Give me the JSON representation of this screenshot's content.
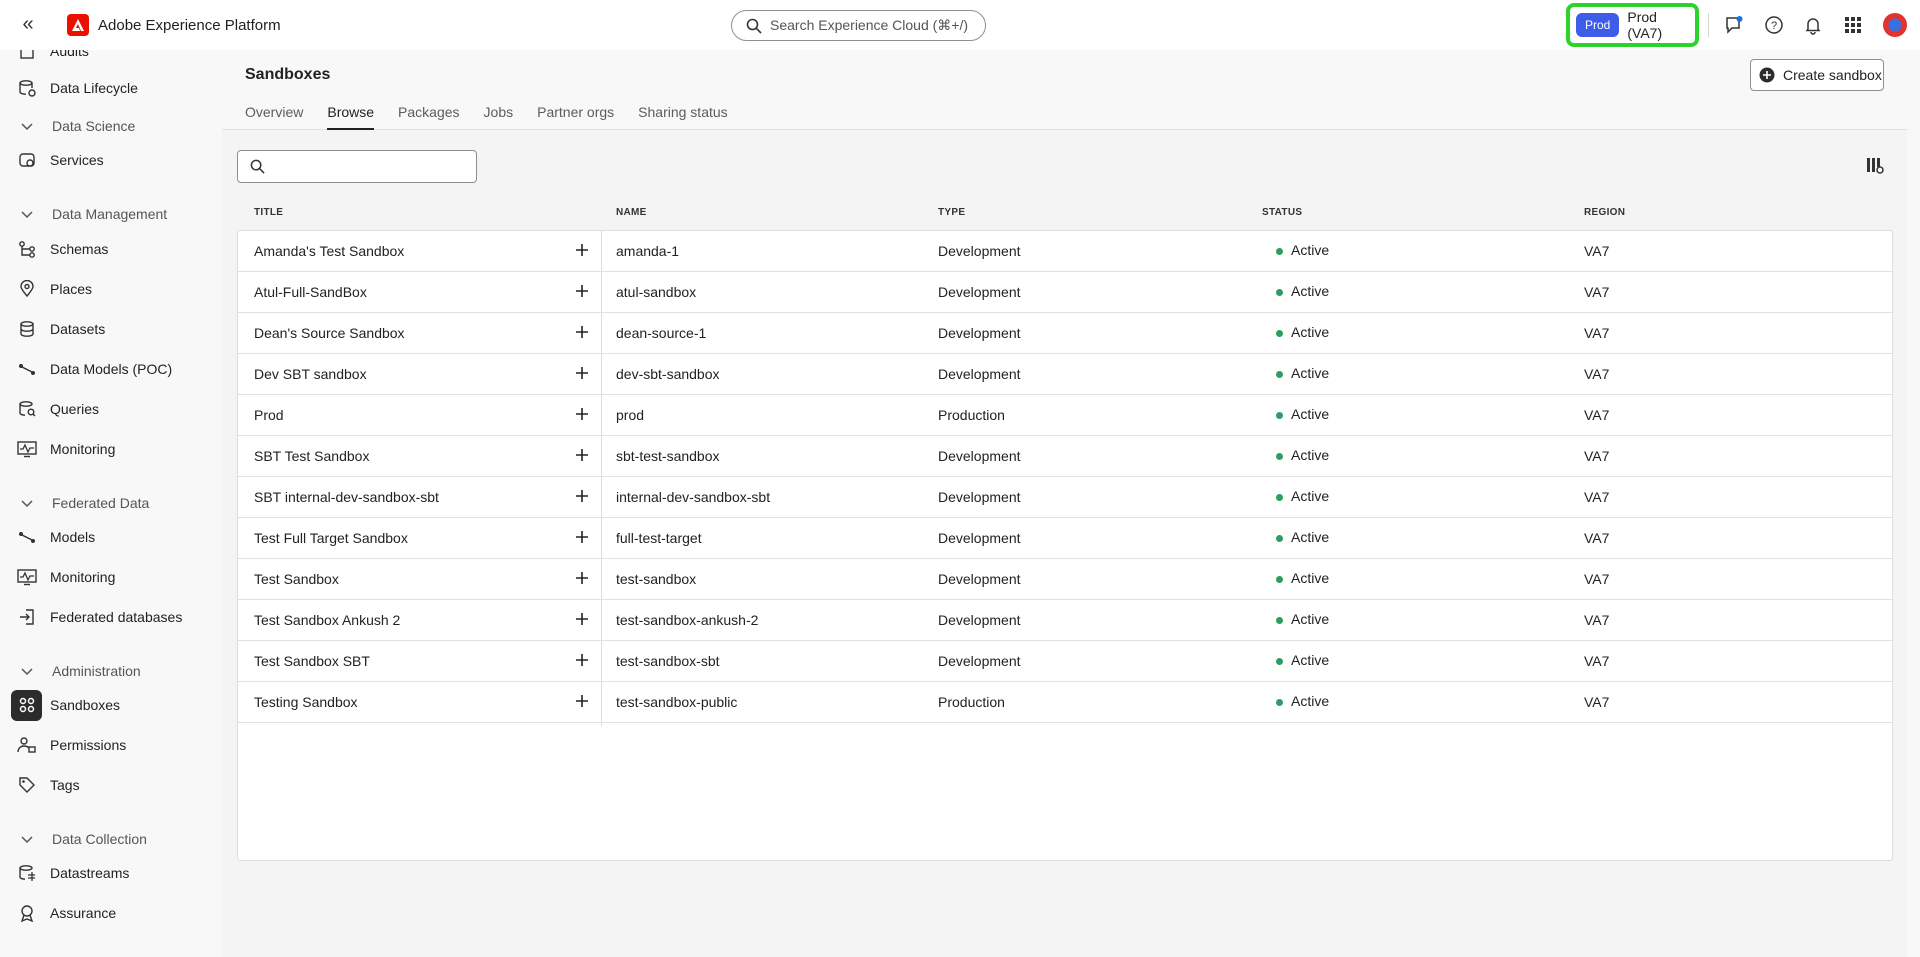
{
  "header": {
    "app_title": "Adobe Experience Platform",
    "search_placeholder": "Search Experience Cloud (⌘+/)",
    "org_badge": "Prod",
    "org_label": "Prod (VA7)"
  },
  "sidebar": {
    "items": [
      {
        "label": "Audits",
        "icon": "audit-icon"
      },
      {
        "label": "Data Lifecycle",
        "icon": "data-lifecycle-icon"
      },
      {
        "label": "Data Science",
        "section": true
      },
      {
        "label": "Services",
        "icon": "services-icon"
      },
      {
        "label": "Data Management",
        "section": true
      },
      {
        "label": "Schemas",
        "icon": "schemas-icon"
      },
      {
        "label": "Places",
        "icon": "places-icon"
      },
      {
        "label": "Datasets",
        "icon": "datasets-icon"
      },
      {
        "label": "Data Models (POC)",
        "icon": "data-models-icon"
      },
      {
        "label": "Queries",
        "icon": "queries-icon"
      },
      {
        "label": "Monitoring",
        "icon": "monitoring-icon"
      },
      {
        "label": "Federated Data",
        "section": true
      },
      {
        "label": "Models",
        "icon": "models-icon"
      },
      {
        "label": "Monitoring",
        "icon": "monitoring-icon"
      },
      {
        "label": "Federated databases",
        "icon": "federated-databases-icon"
      },
      {
        "label": "Administration",
        "section": true
      },
      {
        "label": "Sandboxes",
        "icon": "sandboxes-icon",
        "active": true
      },
      {
        "label": "Permissions",
        "icon": "permissions-icon"
      },
      {
        "label": "Tags",
        "icon": "tags-icon"
      },
      {
        "label": "Data Collection",
        "section": true
      },
      {
        "label": "Datastreams",
        "icon": "datastreams-icon"
      },
      {
        "label": "Assurance",
        "icon": "assurance-icon"
      }
    ]
  },
  "page": {
    "title": "Sandboxes",
    "create_button": "Create sandbox",
    "tabs": [
      "Overview",
      "Browse",
      "Packages",
      "Jobs",
      "Partner orgs",
      "Sharing status"
    ],
    "active_tab": "Browse",
    "filter_placeholder": ""
  },
  "table": {
    "columns": [
      "TITLE",
      "NAME",
      "TYPE",
      "STATUS",
      "REGION"
    ],
    "rows": [
      {
        "title": "Amanda's Test Sandbox",
        "name": "amanda-1",
        "type": "Development",
        "status": "Active",
        "region": "VA7"
      },
      {
        "title": "Atul-Full-SandBox",
        "name": "atul-sandbox",
        "type": "Development",
        "status": "Active",
        "region": "VA7"
      },
      {
        "title": "Dean's Source Sandbox",
        "name": "dean-source-1",
        "type": "Development",
        "status": "Active",
        "region": "VA7"
      },
      {
        "title": "Dev SBT sandbox",
        "name": "dev-sbt-sandbox",
        "type": "Development",
        "status": "Active",
        "region": "VA7"
      },
      {
        "title": "Prod",
        "name": "prod",
        "type": "Production",
        "status": "Active",
        "region": "VA7"
      },
      {
        "title": "SBT Test Sandbox",
        "name": "sbt-test-sandbox",
        "type": "Development",
        "status": "Active",
        "region": "VA7"
      },
      {
        "title": "SBT internal-dev-sandbox-sbt",
        "name": "internal-dev-sandbox-sbt",
        "type": "Development",
        "status": "Active",
        "region": "VA7"
      },
      {
        "title": "Test Full Target Sandbox",
        "name": "full-test-target",
        "type": "Development",
        "status": "Active",
        "region": "VA7"
      },
      {
        "title": "Test Sandbox",
        "name": "test-sandbox",
        "type": "Development",
        "status": "Active",
        "region": "VA7"
      },
      {
        "title": "Test Sandbox Ankush 2",
        "name": "test-sandbox-ankush-2",
        "type": "Development",
        "status": "Active",
        "region": "VA7"
      },
      {
        "title": "Test Sandbox SBT",
        "name": "test-sandbox-sbt",
        "type": "Development",
        "status": "Active",
        "region": "VA7"
      },
      {
        "title": "Testing Sandbox",
        "name": "test-sandbox-public",
        "type": "Production",
        "status": "Active",
        "region": "VA7"
      }
    ]
  },
  "colors": {
    "brand": "#eb1000",
    "org_badge": "#3d5ce8",
    "highlight": "#2dd32d",
    "status_active": "#2d9d62"
  }
}
